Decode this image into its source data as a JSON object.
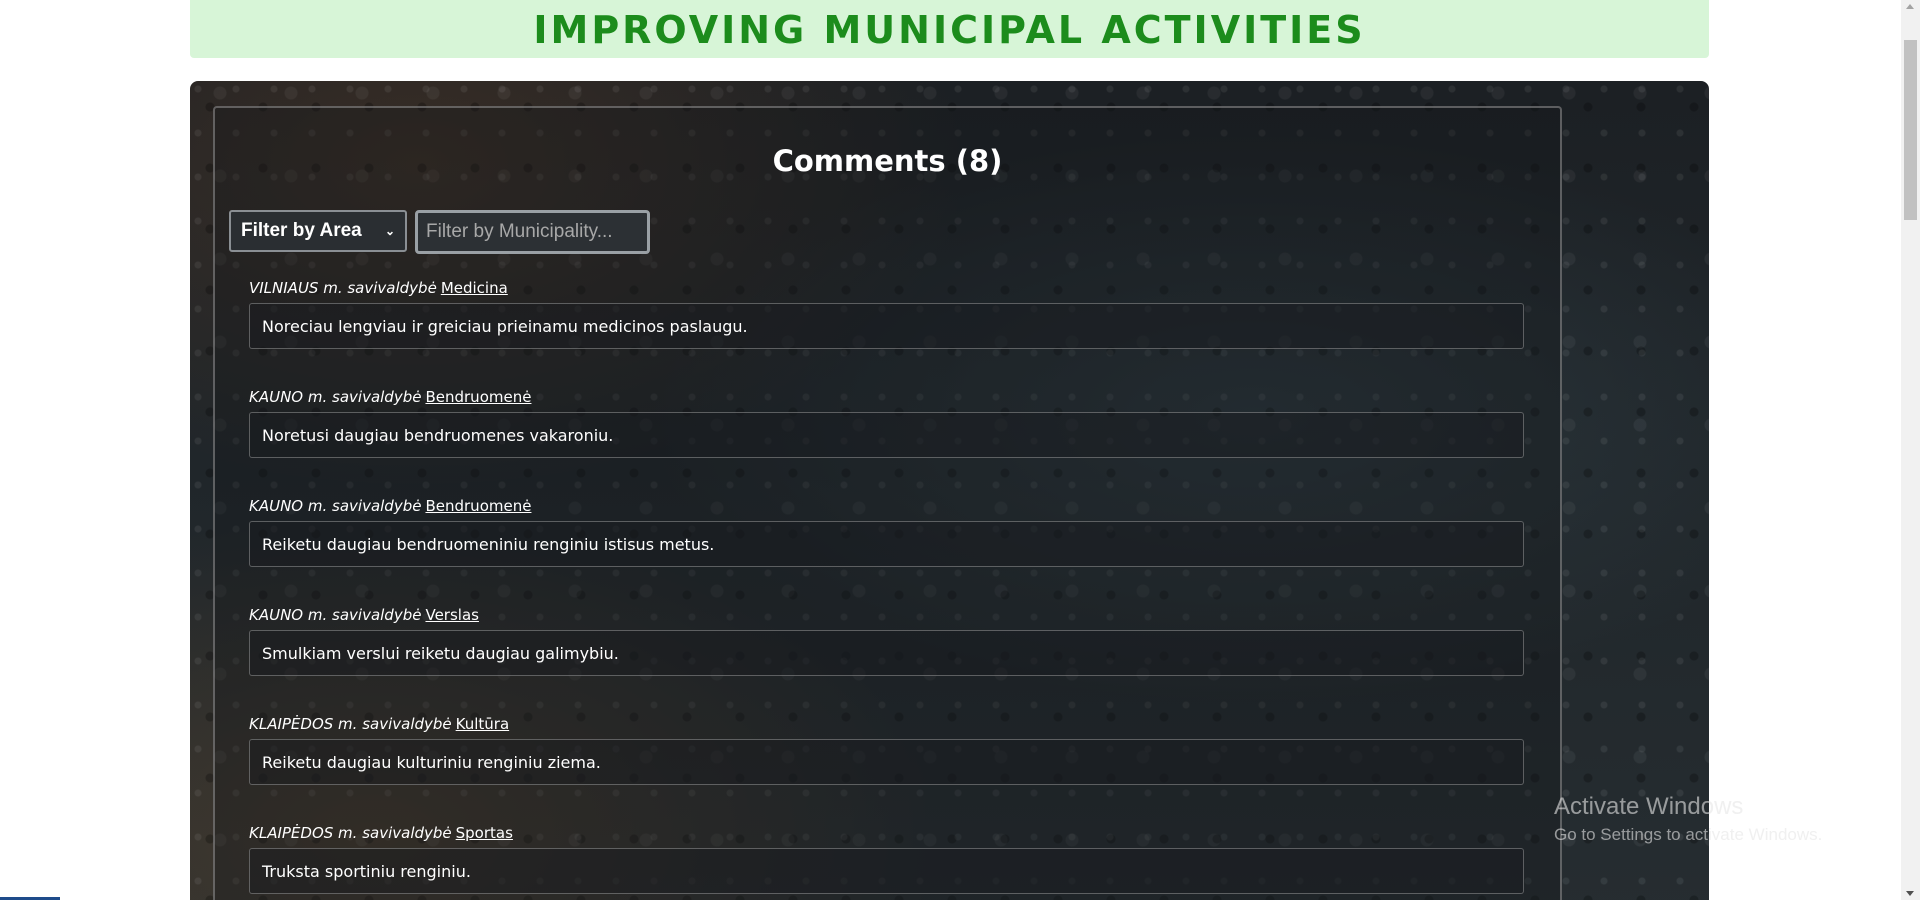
{
  "header": {
    "title": "IMPROVING MUNICIPAL ACTIVITIES"
  },
  "comments_section": {
    "heading": "Comments (8)",
    "filter_area_label": "Filter by Area",
    "filter_municipality_placeholder": "Filter by Municipality..."
  },
  "comments": [
    {
      "municipality": "VILNIAUS m. savivaldybė",
      "area": "Medicina",
      "text": "Noreciau lengviau ir greiciau prieinamu medicinos paslaugu."
    },
    {
      "municipality": "KAUNO m. savivaldybė",
      "area": "Bendruomenė",
      "text": "Noretusi daugiau bendruomenes vakaroniu."
    },
    {
      "municipality": "KAUNO m. savivaldybė",
      "area": "Bendruomenė",
      "text": "Reiketu daugiau bendruomeniniu renginiu istisus metus."
    },
    {
      "municipality": "KAUNO m. savivaldybė",
      "area": "Verslas",
      "text": "Smulkiam verslui reiketu daugiau galimybiu."
    },
    {
      "municipality": "KLAIPĖDOS m. savivaldybė",
      "area": "Kultūra",
      "text": "Reiketu daugiau kulturiniu renginiu ziema."
    },
    {
      "municipality": "KLAIPĖDOS m. savivaldybė",
      "area": "Sportas",
      "text": "Truksta sportiniu renginiu."
    }
  ],
  "watermark": {
    "title": "Activate Windows",
    "subtitle": "Go to Settings to activate Windows."
  },
  "colors": {
    "header_bg": "#d7f5d7",
    "header_text": "#1c8c1c"
  }
}
